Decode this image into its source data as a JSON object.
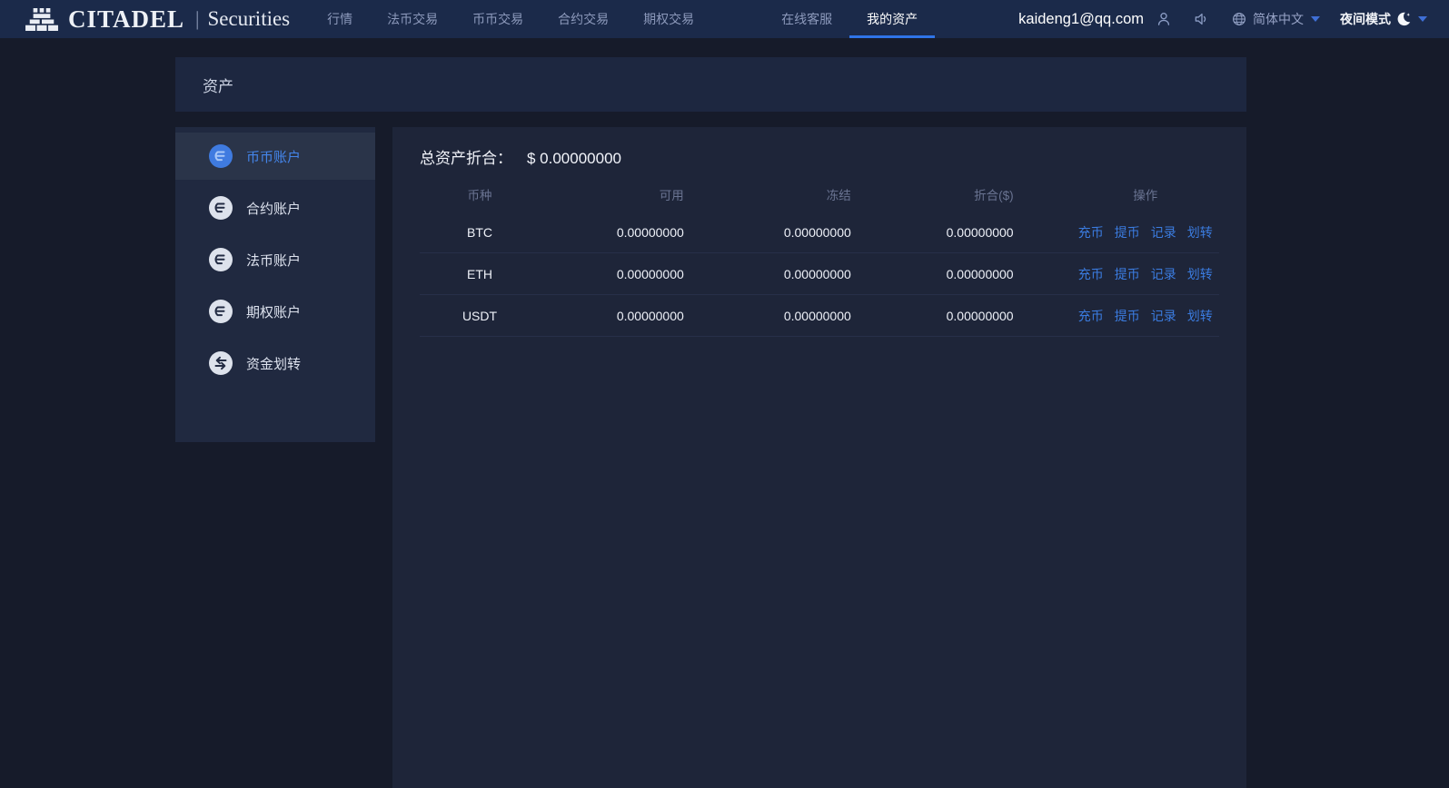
{
  "navbar": {
    "brand_name": "CITADEL",
    "brand_divider": "|",
    "brand_suffix": "Securities",
    "items": [
      {
        "label": "行情",
        "active": false
      },
      {
        "label": "法币交易",
        "active": false
      },
      {
        "label": "币币交易",
        "active": false
      },
      {
        "label": "合约交易",
        "active": false
      },
      {
        "label": "期权交易",
        "active": false
      },
      {
        "label": "在线客服",
        "active": false
      },
      {
        "label": "我的资产",
        "active": true
      }
    ],
    "user_email": "kaideng1@qq.com",
    "language": "简体中文",
    "theme_label": "夜间模式"
  },
  "page": {
    "title": "资产"
  },
  "sidebar": {
    "items": [
      {
        "label": "币币账户",
        "icon": "account",
        "active": true
      },
      {
        "label": "合约账户",
        "icon": "account",
        "active": false
      },
      {
        "label": "法币账户",
        "icon": "account",
        "active": false
      },
      {
        "label": "期权账户",
        "icon": "account",
        "active": false
      },
      {
        "label": "资金划转",
        "icon": "transfer",
        "active": false
      }
    ]
  },
  "assets": {
    "total_label": "总资产折合：",
    "total_value": "$ 0.00000000",
    "table": {
      "headers": [
        "币种",
        "可用",
        "冻结",
        "折合($)",
        "操作"
      ],
      "actions": [
        "充币",
        "提币",
        "记录",
        "划转"
      ],
      "rows": [
        {
          "coin": "BTC",
          "available": "0.00000000",
          "frozen": "0.00000000",
          "converted": "0.00000000"
        },
        {
          "coin": "ETH",
          "available": "0.00000000",
          "frozen": "0.00000000",
          "converted": "0.00000000"
        },
        {
          "coin": "USDT",
          "available": "0.00000000",
          "frozen": "0.00000000",
          "converted": "0.00000000"
        }
      ]
    }
  },
  "colors": {
    "navbar_bg": "#1b2a4a",
    "page_bg": "#161b2a",
    "panel_bg": "#1e2539",
    "sidebar_bg": "#202940",
    "sidebar_active_bg": "#2a3449",
    "header_box_bg": "#1d2740",
    "accent_blue": "#2f74e8",
    "link_blue": "#3b7ce0",
    "muted_text": "#8c99bb",
    "table_header_text": "#6a7492",
    "row_divider": "#272f49"
  }
}
